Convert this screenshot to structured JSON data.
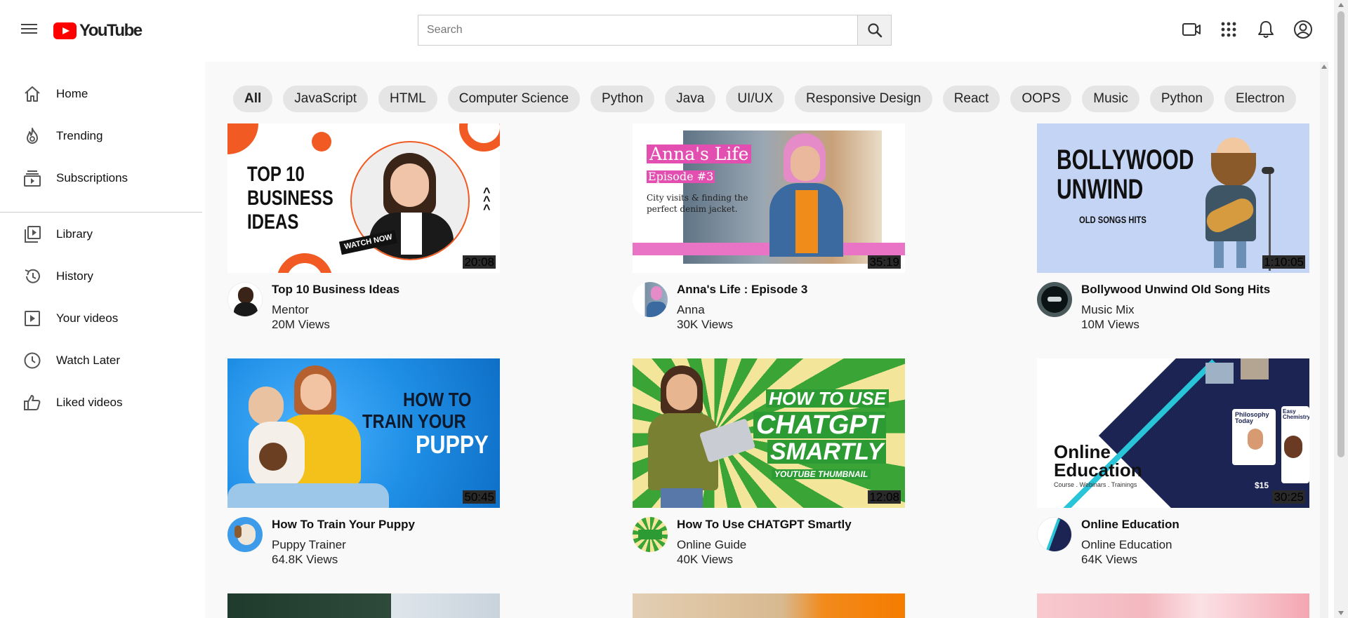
{
  "header": {
    "logo_text": "YouTube",
    "search_placeholder": "Search"
  },
  "sidebar": {
    "items": [
      {
        "label": "Home",
        "icon": "home-icon"
      },
      {
        "label": "Trending",
        "icon": "trending-icon"
      },
      {
        "label": "Subscriptions",
        "icon": "subscriptions-icon"
      },
      {
        "label": "Library",
        "icon": "library-icon"
      },
      {
        "label": "History",
        "icon": "history-icon"
      },
      {
        "label": "Your videos",
        "icon": "your-videos-icon"
      },
      {
        "label": "Watch Later",
        "icon": "watch-later-icon"
      },
      {
        "label": "Liked videos",
        "icon": "liked-videos-icon"
      }
    ]
  },
  "chips": [
    "All",
    "JavaScript",
    "HTML",
    "Computer Science",
    "Python",
    "Java",
    "UI/UX",
    "Responsive Design",
    "React",
    "OOPS",
    "Music",
    "Python",
    "Electron"
  ],
  "thumbnail_text": {
    "business_1": "TOP 10",
    "business_2": "BUSINESS",
    "business_3": "IDEAS",
    "business_badge": "WATCH NOW",
    "anna_title": "Anna's Life",
    "anna_episode": "Episode #3",
    "anna_caption": "City visits & finding the perfect denim jacket.",
    "bollywood_1": "BOLLYWOOD",
    "bollywood_2": "UNWIND",
    "bollywood_3": "OLD SONGS HITS",
    "puppy_1": "HOW TO",
    "puppy_2": "TRAIN YOUR",
    "puppy_3": "PUPPY",
    "chatgpt_1": "HOW TO USE",
    "chatgpt_2": "CHATGPT",
    "chatgpt_3": "SMARTLY",
    "chatgpt_4": "YOUTUBE THUMBNAIL",
    "edu_1": "Online",
    "edu_2": "Education",
    "edu_3": "Course . Webinars . Trainings",
    "edu_card1": "Philosophy Today",
    "edu_card2": "Easy Chemistry",
    "edu_price": "$15"
  },
  "videos": [
    {
      "title": "Top 10 Business Ideas",
      "channel": "Mentor",
      "views": "20M Views",
      "duration": "20:08"
    },
    {
      "title": "Anna's Life : Episode 3",
      "channel": "Anna",
      "views": "30K Views",
      "duration": "35:19"
    },
    {
      "title": "Bollywood Unwind Old Song Hits",
      "channel": "Music Mix",
      "views": "10M Views",
      "duration": "1:10:05"
    },
    {
      "title": "How To Train Your Puppy",
      "channel": "Puppy Trainer",
      "views": "64.8K Views",
      "duration": "50:45"
    },
    {
      "title": "How To Use CHATGPT Smartly",
      "channel": "Online Guide",
      "views": "40K Views",
      "duration": "12:08"
    },
    {
      "title": "Online Education",
      "channel": "Online Education",
      "views": "64K Views",
      "duration": "30:25"
    }
  ]
}
